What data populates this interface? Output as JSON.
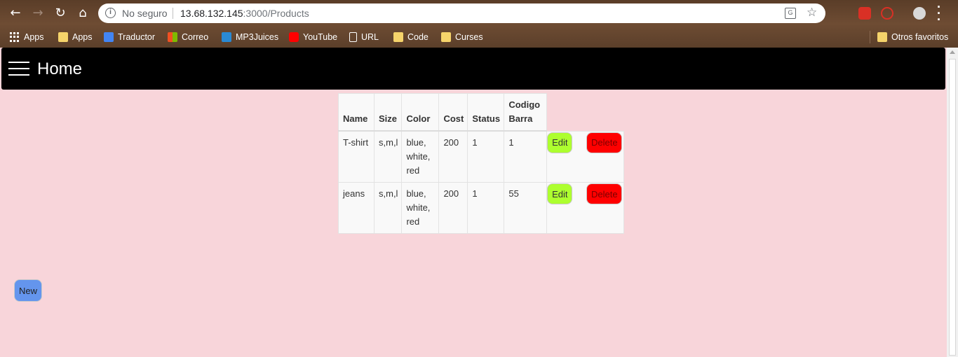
{
  "browser": {
    "security_label": "No seguro",
    "url_host": "13.68.132.145",
    "url_rest": ":3000/Products",
    "bookmarks": [
      {
        "label": "Apps",
        "icon": "apps-grid-icon"
      },
      {
        "label": "Apps",
        "icon": "folder-icon"
      },
      {
        "label": "Traductor",
        "icon": "google-translate-icon"
      },
      {
        "label": "Correo",
        "icon": "microsoft-icon"
      },
      {
        "label": "MP3Juices",
        "icon": "download-icon"
      },
      {
        "label": "YouTube",
        "icon": "youtube-icon"
      },
      {
        "label": "URL",
        "icon": "page-icon"
      },
      {
        "label": "Code",
        "icon": "folder-icon"
      },
      {
        "label": "Curses",
        "icon": "folder-icon"
      }
    ],
    "other_bookmarks": "Otros favoritos"
  },
  "appbar": {
    "title": "Home"
  },
  "table": {
    "headers": [
      "Name",
      "Size",
      "Color",
      "Cost",
      "Status",
      "Codigo Barra"
    ],
    "rows": [
      {
        "name": "T-shirt",
        "size": "s,m,l",
        "color": "blue, white, red",
        "cost": "200",
        "status": "1",
        "codigo": "1"
      },
      {
        "name": "jeans",
        "size": "s,m,l",
        "color": "blue, white, red",
        "cost": "200",
        "status": "1",
        "codigo": "55"
      }
    ],
    "edit_label": "Edit",
    "delete_label": "Delete"
  },
  "new_label": "New",
  "colors": {
    "page_bg": "#f8d5da",
    "edit": "#adff2f",
    "delete": "#ff0000",
    "new": "#6495ed"
  }
}
